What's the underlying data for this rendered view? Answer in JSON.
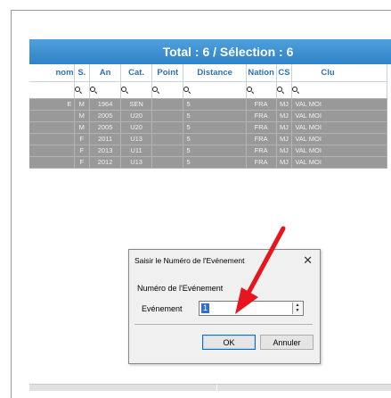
{
  "grid": {
    "title": "Total : 6 / Sélection : 6",
    "columns": [
      {
        "label": "nom"
      },
      {
        "label": "S."
      },
      {
        "label": "An"
      },
      {
        "label": "Cat."
      },
      {
        "label": "Point"
      },
      {
        "label": "Distance"
      },
      {
        "label": "Nation"
      },
      {
        "label": "CS"
      },
      {
        "label": "Clu"
      }
    ],
    "rows": [
      {
        "nom": "E",
        "sexe": "M",
        "an": "1964",
        "cat": "SEN",
        "point": "",
        "distance": "5",
        "nation": "FRA",
        "cs": "MJ",
        "club": "VAL MOI"
      },
      {
        "nom": "",
        "sexe": "M",
        "an": "2005",
        "cat": "U20",
        "point": "",
        "distance": "5",
        "nation": "FRA",
        "cs": "MJ",
        "club": "VAL MOI"
      },
      {
        "nom": "",
        "sexe": "M",
        "an": "2005",
        "cat": "U20",
        "point": "",
        "distance": "5",
        "nation": "FRA",
        "cs": "MJ",
        "club": "VAL MOI"
      },
      {
        "nom": "",
        "sexe": "F",
        "an": "2011",
        "cat": "U13",
        "point": "",
        "distance": "5",
        "nation": "FRA",
        "cs": "MJ",
        "club": "VAL MOI"
      },
      {
        "nom": "",
        "sexe": "F",
        "an": "2013",
        "cat": "U11",
        "point": "",
        "distance": "5",
        "nation": "FRA",
        "cs": "MJ",
        "club": "VAL MOI"
      },
      {
        "nom": "",
        "sexe": "F",
        "an": "2012",
        "cat": "U13",
        "point": "",
        "distance": "5",
        "nation": "FRA",
        "cs": "MJ",
        "club": "VAL MOI"
      }
    ]
  },
  "dialog": {
    "title": "Saisir le Numéro de l'Evénement",
    "close_icon": "close-icon",
    "group_label": "Numéro de l'Evénement",
    "field_label": "Evénement",
    "field_value": "1",
    "ok_label": "OK",
    "cancel_label": "Annuler"
  },
  "colors": {
    "title_bar": "#2f82c6",
    "header_text": "#2e73b8",
    "row_bg": "#999999",
    "arrow": "#e8141e"
  }
}
